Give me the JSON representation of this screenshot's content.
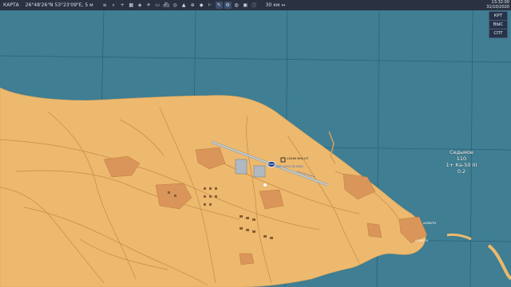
{
  "toolbar": {
    "map_label": "КАРТА",
    "coords": "26°48'26\"N 53°23'09\"E, 5 м",
    "scale": "30 км ↔",
    "icons": [
      "menu-icon",
      "search-icon",
      "zoom-in-icon",
      "grid-icon",
      "layers-icon",
      "plane-icon",
      "vehicle-icon",
      "ship-icon",
      "target-icon",
      "sam-icon",
      "airfield-icon",
      "waypoint-icon",
      "ruler-icon",
      "draw-icon",
      "settings-icon",
      "globe-icon",
      "camera-icon",
      "info-icon"
    ]
  },
  "clock": {
    "time": "13:32:00",
    "date": "31/10/2020"
  },
  "right_buttons": [
    "КРТ",
    "ВЫС",
    "СПТ"
  ],
  "unit_group": {
    "name": "Седьмое",
    "number": "110",
    "line": "1+   Ка-50 III",
    "sub": "0.2"
  },
  "airfield": {
    "label": "118.60 MHz LIT",
    "sub": "DDS 15/33 18 KM/H"
  },
  "map_texts": [
    "AZIMUTH",
    "AZIMUTH"
  ],
  "colors": {
    "sea": "#3f7e93",
    "land": "#ecb96e",
    "roads": "#c98a4a",
    "grid": "#2d6378",
    "urban": "#d9955a",
    "bar": "#2a3140"
  }
}
